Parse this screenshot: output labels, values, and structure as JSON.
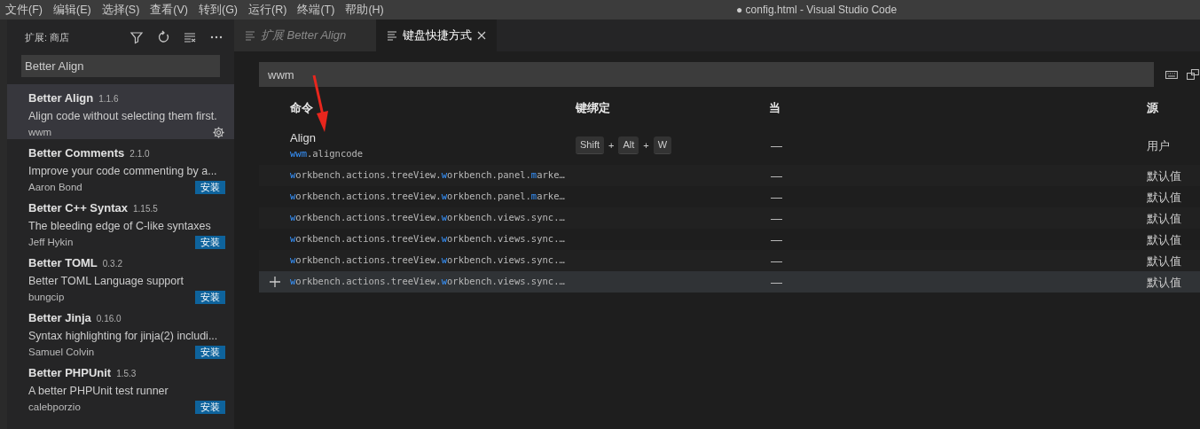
{
  "menu": [
    "文件(F)",
    "编辑(E)",
    "选择(S)",
    "查看(V)",
    "转到(G)",
    "运行(R)",
    "终端(T)",
    "帮助(H)"
  ],
  "window": {
    "title": "● config.html - Visual Studio Code"
  },
  "sidebar": {
    "title": "扩展: 商店",
    "search": {
      "value": "Better Align"
    },
    "items": [
      {
        "name": "Better Align",
        "version": "1.1.6",
        "description": "Align code without selecting them first.",
        "author": "wwm",
        "selected": true,
        "kind": "installed"
      },
      {
        "name": "Better Comments",
        "version": "2.1.0",
        "description": "Improve your code commenting by a...",
        "author": "Aaron Bond",
        "selected": false,
        "kind": "install",
        "button": "安装"
      },
      {
        "name": "Better C++ Syntax",
        "version": "1.15.5",
        "description": "The bleeding edge of C-like syntaxes",
        "author": "Jeff Hykin",
        "selected": false,
        "kind": "install",
        "button": "安装"
      },
      {
        "name": "Better TOML",
        "version": "0.3.2",
        "description": "Better TOML Language support",
        "author": "bungcip",
        "selected": false,
        "kind": "install",
        "button": "安装"
      },
      {
        "name": "Better Jinja",
        "version": "0.16.0",
        "description": "Syntax highlighting for jinja(2) includi...",
        "author": "Samuel Colvin",
        "selected": false,
        "kind": "install",
        "button": "安装"
      },
      {
        "name": "Better PHPUnit",
        "version": "1.5.3",
        "description": "A better PHPUnit test runner",
        "author": "calebporzio",
        "selected": false,
        "kind": "install",
        "button": "安装"
      }
    ]
  },
  "tabs": [
    {
      "label": "扩展 Better Align",
      "selected": false,
      "italic": true
    },
    {
      "label": "键盘快捷方式",
      "selected": true,
      "italic": false
    }
  ],
  "keybindings": {
    "search": {
      "value": "wwm"
    },
    "columns": [
      "命令",
      "键绑定",
      "当",
      "源"
    ],
    "rows": [
      {
        "title": "Align",
        "command": [
          {
            "text": "wwm",
            "match": true
          },
          {
            "text": ".aligncode",
            "match": false
          }
        ],
        "keys": [
          {
            "kind": "key",
            "text": "Shift"
          },
          {
            "kind": "plus",
            "text": "+"
          },
          {
            "kind": "key",
            "text": "Alt"
          },
          {
            "kind": "plus",
            "text": "+"
          },
          {
            "kind": "key",
            "text": "W"
          }
        ],
        "when": "—",
        "source": "用户",
        "hovered": false
      },
      {
        "command": [
          {
            "text": "w",
            "match": true
          },
          {
            "text": "orkbench.actions.treeView.",
            "match": false
          },
          {
            "text": "w",
            "match": true
          },
          {
            "text": "orkbench.panel.",
            "match": false
          },
          {
            "text": "m",
            "match": true
          },
          {
            "text": "arke…",
            "match": false
          }
        ],
        "when": "—",
        "source": "默认值",
        "hovered": false
      },
      {
        "command": [
          {
            "text": "w",
            "match": true
          },
          {
            "text": "orkbench.actions.treeView.",
            "match": false
          },
          {
            "text": "w",
            "match": true
          },
          {
            "text": "orkbench.panel.",
            "match": false
          },
          {
            "text": "m",
            "match": true
          },
          {
            "text": "arke…",
            "match": false
          }
        ],
        "when": "—",
        "source": "默认值",
        "hovered": false
      },
      {
        "command": [
          {
            "text": "w",
            "match": true
          },
          {
            "text": "orkbench.actions.treeView.",
            "match": false
          },
          {
            "text": "w",
            "match": true
          },
          {
            "text": "orkbench.views.sync.…",
            "match": false
          }
        ],
        "when": "—",
        "source": "默认值",
        "hovered": false
      },
      {
        "command": [
          {
            "text": "w",
            "match": true
          },
          {
            "text": "orkbench.actions.treeView.",
            "match": false
          },
          {
            "text": "w",
            "match": true
          },
          {
            "text": "orkbench.views.sync.…",
            "match": false
          }
        ],
        "when": "—",
        "source": "默认值",
        "hovered": false
      },
      {
        "command": [
          {
            "text": "w",
            "match": true
          },
          {
            "text": "orkbench.actions.treeView.",
            "match": false
          },
          {
            "text": "w",
            "match": true
          },
          {
            "text": "orkbench.views.sync.…",
            "match": false
          }
        ],
        "when": "—",
        "source": "默认值",
        "hovered": false
      },
      {
        "command": [
          {
            "text": "w",
            "match": true
          },
          {
            "text": "orkbench.actions.treeView.",
            "match": false
          },
          {
            "text": "w",
            "match": true
          },
          {
            "text": "orkbench.views.sync.…",
            "match": false
          }
        ],
        "when": "—",
        "source": "默认值",
        "hovered": true
      }
    ]
  }
}
